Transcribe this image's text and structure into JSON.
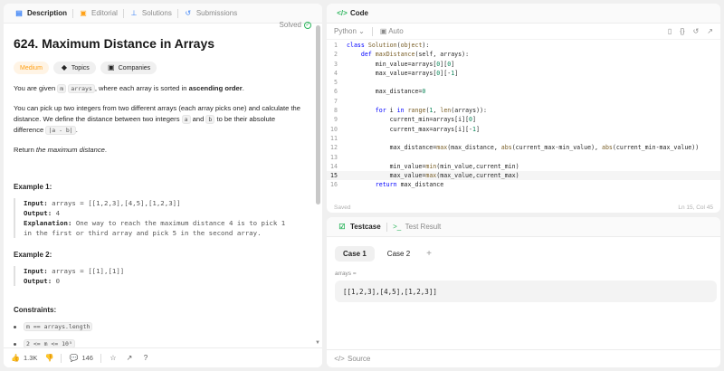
{
  "left_tabs": [
    {
      "label": "Description",
      "icon": "description-icon",
      "active": true
    },
    {
      "label": "Editorial",
      "icon": "editorial-icon",
      "active": false
    },
    {
      "label": "Solutions",
      "icon": "solutions-icon",
      "active": false
    },
    {
      "label": "Submissions",
      "icon": "submissions-icon",
      "active": false
    }
  ],
  "problem": {
    "title": "624. Maximum Distance in Arrays",
    "status": "Solved",
    "difficulty": "Medium",
    "topics_label": "Topics",
    "companies_label": "Companies",
    "para1_a": "You are given ",
    "para1_code": "m",
    "para1_b": " ",
    "para1_code2": "arrays",
    "para1_c": ", where each array is sorted in ",
    "para1_bold": "ascending order",
    "para1_d": ".",
    "para2_a": "You can pick up two integers from two different arrays (each array picks one) and calculate the distance. We define the distance between two integers ",
    "para2_code_a": "a",
    "para2_b": " and ",
    "para2_code_b": "b",
    "para2_c": " to be their absolute difference ",
    "para2_code_c": "|a - b|",
    "para2_d": ".",
    "para3_a": "Return ",
    "para3_em": "the maximum distance",
    "para3_b": ".",
    "example1": {
      "title": "Example 1:",
      "input_label": "Input:",
      "input": "arrays = [[1,2,3],[4,5],[1,2,3]]",
      "output_label": "Output:",
      "output": "4",
      "explanation_label": "Explanation:",
      "explanation_1": "One way to reach the maximum distance 4 is to pick 1",
      "explanation_2": "in the first or third array and pick 5 in the second array."
    },
    "example2": {
      "title": "Example 2:",
      "input_label": "Input:",
      "input": "arrays = [[1],[1]]",
      "output_label": "Output:",
      "output": "0"
    },
    "constraints_title": "Constraints:",
    "constraint1": "m == arrays.length",
    "constraint2": "2 <= m <= 10⁵"
  },
  "footer": {
    "likes": "1.3K",
    "comments": "146"
  },
  "code_panel": {
    "title": "Code",
    "language": "Python",
    "mode": "Auto",
    "status_left": "Saved",
    "status_right": "Ln 15, Col 45",
    "lines": [
      "class Solution(object):",
      "    def maxDistance(self, arrays):",
      "        min_value=arrays[0][0]",
      "        max_value=arrays[0][-1]",
      "",
      "        max_distance=0",
      "",
      "        for i in range(1, len(arrays)):",
      "            current_min=arrays[i][0]",
      "            current_max=arrays[i][-1]",
      "",
      "            max_distance=max(max_distance, abs(current_max-min_value), abs(current_min-max_value))",
      "",
      "            min_value=min(min_value,current_min)",
      "            max_value=max(max_value,current_max)",
      "        return max_distance"
    ],
    "current_line": 15
  },
  "test_panel": {
    "tab_testcase": "Testcase",
    "tab_result": "Test Result",
    "cases": [
      "Case 1",
      "Case 2"
    ],
    "add_label": "+",
    "param_label": "arrays =",
    "param_value": "[[1,2,3],[4,5],[1,2,3]]",
    "source_label": "Source"
  },
  "colors": {
    "accent_green": "#2db55d",
    "medium_orange": "#ffa116",
    "keyword_blue": "#0000ff"
  }
}
